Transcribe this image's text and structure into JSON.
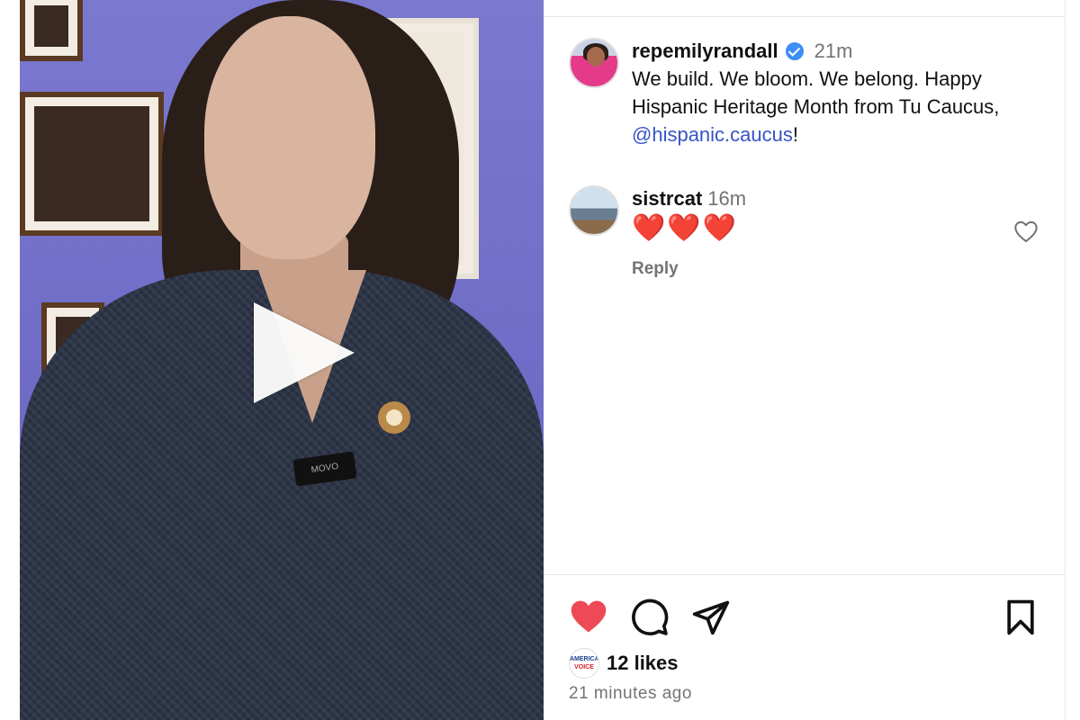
{
  "video": {
    "play_icon": "play-icon",
    "mic_label": "MOVO"
  },
  "post": {
    "username": "repemilyrandall",
    "time": "21m",
    "caption_text": "We build. We bloom. We belong. Happy Hispanic Heritage Month from Tu Caucus, ",
    "mention": "@hispanic.caucus",
    "caption_end": "!"
  },
  "comment": {
    "username": "sistrcat",
    "time": "16m",
    "text": "❤️❤️❤️",
    "reply_label": "Reply"
  },
  "liker": {
    "line1": "AMERICA'S",
    "line2": "VOICE"
  },
  "footer": {
    "likes": "12 likes",
    "timestamp": "21 minutes ago"
  },
  "colors": {
    "like": "#ed4956",
    "link": "#3753c7",
    "verified": "#3f8ef5",
    "muted": "#737373"
  }
}
